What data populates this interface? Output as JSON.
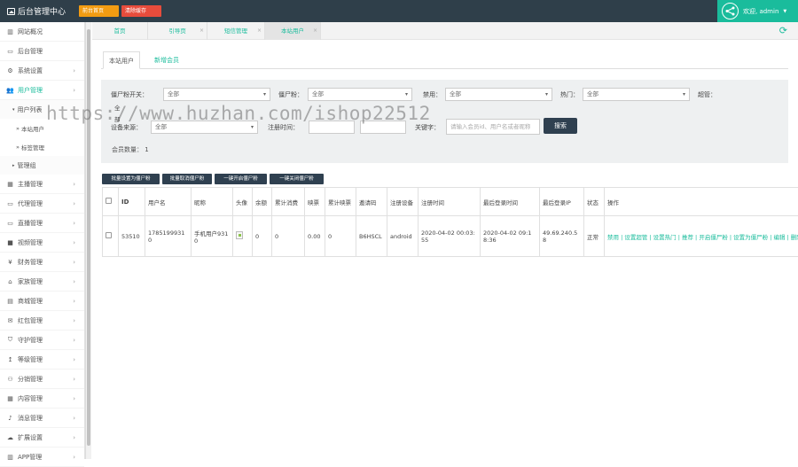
{
  "topbar": {
    "title": "后台管理中心",
    "home_button": "前台首页",
    "clear_cache_button": "清除缓存",
    "user_greeting": "欢迎, admin"
  },
  "sidebar": {
    "items": [
      {
        "label": "网站概况",
        "icon": "chart-bar-icon"
      },
      {
        "label": "后台管理",
        "icon": "monitor-icon"
      },
      {
        "label": "系统设置",
        "icon": "gear-icon"
      },
      {
        "label": "用户管理",
        "icon": "users-icon",
        "active": true
      }
    ],
    "user_group": "用户列表",
    "user_sub": [
      "本站用户",
      "标签管理"
    ],
    "manage_group": "管理组",
    "items2": [
      {
        "label": "主播管理",
        "icon": "calendar-icon"
      },
      {
        "label": "代理管理",
        "icon": "monitor-icon"
      },
      {
        "label": "直播管理",
        "icon": "monitor-icon"
      },
      {
        "label": "视频管理",
        "icon": "video-icon"
      },
      {
        "label": "财务管理",
        "icon": "yen-icon"
      },
      {
        "label": "家族管理",
        "icon": "bank-icon"
      },
      {
        "label": "商城管理",
        "icon": "store-icon"
      },
      {
        "label": "红包管理",
        "icon": "envelope-icon"
      },
      {
        "label": "守护管理",
        "icon": "shield-icon"
      },
      {
        "label": "等级管理",
        "icon": "level-icon"
      },
      {
        "label": "分销管理",
        "icon": "sitemap-icon"
      },
      {
        "label": "内容管理",
        "icon": "grid-icon"
      },
      {
        "label": "消息管理",
        "icon": "bell-icon"
      },
      {
        "label": "扩展设置",
        "icon": "cloud-icon"
      },
      {
        "label": "APP管理",
        "icon": "app-icon"
      }
    ]
  },
  "tabs": [
    {
      "label": "首页"
    },
    {
      "label": "引导页"
    },
    {
      "label": "短信管理"
    },
    {
      "label": "本站用户",
      "active": true
    }
  ],
  "subtabs": {
    "active": "本站用户",
    "other": "新增会员"
  },
  "filter": {
    "robot_label": "僵尸粉开关：",
    "robot_value": "全部",
    "zombie_label": "僵尸粉：",
    "zombie_value": "全部",
    "ban_label": "禁用：",
    "ban_value": "全部",
    "hot_label": "热门：",
    "hot_value": "全部",
    "super_label": "超管：",
    "super_value": "全部",
    "device_label": "设备来源：",
    "device_value": "全部",
    "regtime_label": "注册时间：",
    "keyword_label": "关键字：",
    "keyword_placeholder": "请输入会员id、用户名或者昵称",
    "search_button": "搜索",
    "count_text": "会员数量： 1"
  },
  "actions": [
    "批量设置为僵尸粉",
    "批量取消僵尸粉",
    "一键开启僵尸粉",
    "一键关闭僵尸粉"
  ],
  "table": {
    "headers": [
      "ID",
      "用户名",
      "昵称",
      "头像",
      "余额",
      "累计消费",
      "映票",
      "累计映票",
      "邀请码",
      "注册设备",
      "注册时间",
      "最后登录时间",
      "最后登录IP",
      "状态",
      "操作"
    ],
    "rows": [
      {
        "id": "53510",
        "username": "17851999310",
        "nickname": "手机用户9310",
        "balance": "0",
        "consumption": "0",
        "votes": "0.00",
        "total_votes": "0",
        "invite_code": "B6HSCL",
        "device": "android",
        "reg_time": "2020-04-02 00:03:55",
        "last_login": "2020-04-02 09:18:36",
        "last_ip": "49.69.240.58",
        "status": "正常",
        "ops": [
          "禁用",
          "设置超管",
          "设置热门",
          "推荐",
          "开启僵尸粉",
          "设置为僵尸粉",
          "编辑",
          "删除"
        ]
      }
    ]
  },
  "watermark": "https://www.huzhan.com/ishop22512",
  "colors": {
    "accent": "#1abc9c",
    "dark": "#2f4050",
    "topbar": "#2f3f4a",
    "orange": "#f39c12",
    "red": "#e74c3c"
  }
}
